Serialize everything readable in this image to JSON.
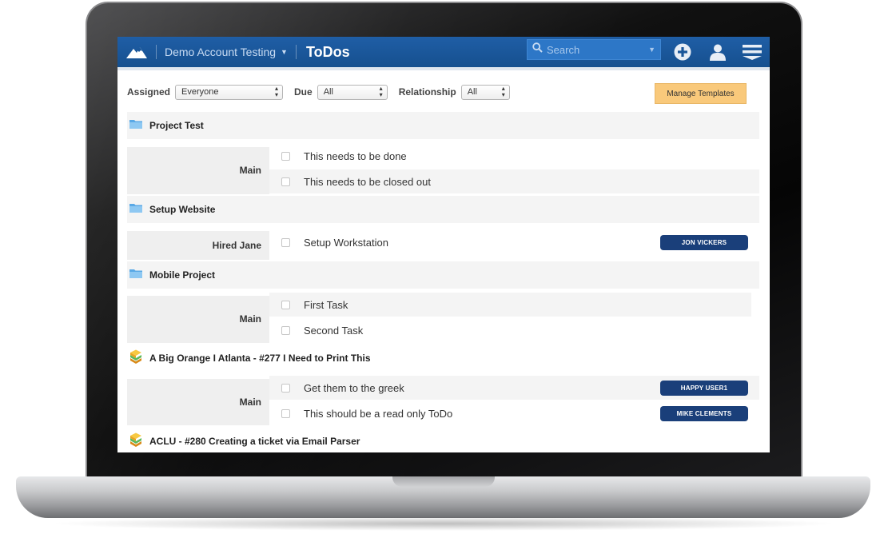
{
  "header": {
    "account_name": "Demo Account Testing",
    "page_title": "ToDos",
    "search_placeholder": "Search"
  },
  "filters": {
    "assigned_label": "Assigned",
    "assigned_value": "Everyone",
    "due_label": "Due",
    "due_value": "All",
    "relationship_label": "Relationship",
    "relationship_value": "All",
    "manage_templates_label": "Manage Templates"
  },
  "groups": [
    {
      "title": "Project Test",
      "icon": "folder-icon",
      "sections": [
        {
          "label": "Main",
          "tasks": [
            {
              "text": "This needs to be done",
              "assignee": ""
            },
            {
              "text": "This needs to be closed out",
              "assignee": ""
            }
          ]
        }
      ]
    },
    {
      "title": "Setup Website",
      "icon": "folder-icon",
      "sections": [
        {
          "label": "Hired Jane",
          "tasks": [
            {
              "text": "Setup Workstation",
              "assignee": "JON VICKERS"
            }
          ]
        }
      ]
    },
    {
      "title": "Mobile Project",
      "icon": "folder-icon",
      "sections": [
        {
          "label": "Main",
          "tasks": [
            {
              "text": "First Task",
              "assignee": ""
            },
            {
              "text": "Second Task",
              "assignee": ""
            }
          ]
        }
      ]
    },
    {
      "title": "A Big Orange I Atlanta - #277 I Need to Print This",
      "icon": "ticket-stack-icon",
      "sections": [
        {
          "label": "Main",
          "tasks": [
            {
              "text": "Get them to the greek",
              "assignee": "HAPPY USER1"
            },
            {
              "text": "This should be a read only ToDo",
              "assignee": "MIKE CLEMENTS"
            }
          ]
        }
      ]
    },
    {
      "title": "ACLU - #280 Creating a ticket via Email Parser",
      "icon": "ticket-stack-icon",
      "sections": []
    }
  ],
  "colors": {
    "header_blue": "#1a5699",
    "assignee_badge": "#1a3f7a",
    "manage_button": "#f9c97b",
    "folder": "#5aa9e6"
  }
}
